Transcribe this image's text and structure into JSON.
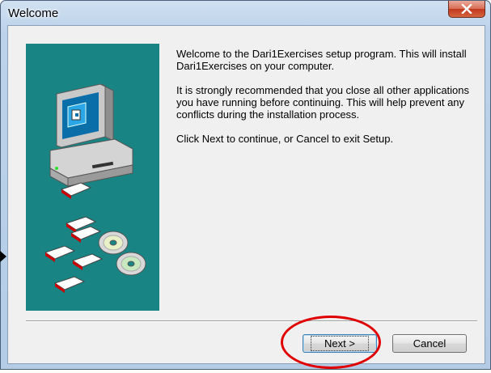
{
  "window": {
    "title": "Welcome",
    "close_glyph": "X"
  },
  "content": {
    "paragraphs": [
      "Welcome to the Dari1Exercises setup program. This will install Dari1Exercises on your computer.",
      "It is strongly recommended that you close all other applications you have running before continuing. This will help prevent any conflicts during the installation process.",
      "Click Next to continue, or Cancel to exit Setup."
    ]
  },
  "buttons": {
    "next_label": "Next >",
    "cancel_label": "Cancel"
  },
  "colors": {
    "side_panel": "#188484",
    "highlight_ellipse": "#e00000"
  },
  "icons": {
    "side_illustration": "computer-with-disks-illustration",
    "close": "close-icon"
  }
}
